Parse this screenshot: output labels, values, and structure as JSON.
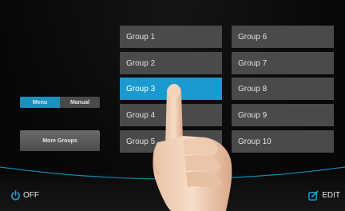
{
  "mode_toggle": {
    "menu_label": "Menu",
    "manual_label": "Manual",
    "selected": "Menu"
  },
  "more_groups_label": "More Groups",
  "groups": [
    {
      "label": "Group 1",
      "active": false
    },
    {
      "label": "Group 2",
      "active": false
    },
    {
      "label": "Group 3",
      "active": true
    },
    {
      "label": "Group 4",
      "active": false
    },
    {
      "label": "Group 5",
      "active": false
    },
    {
      "label": "Group 6",
      "active": false
    },
    {
      "label": "Group 7",
      "active": false
    },
    {
      "label": "Group 8",
      "active": false
    },
    {
      "label": "Group 9",
      "active": false
    },
    {
      "label": "Group 10",
      "active": false
    }
  ],
  "bottom_bar": {
    "off_label": "OFF",
    "edit_label": "EDIT"
  },
  "colors": {
    "accent": "#1a9ad0",
    "button": "#4a4a4a",
    "background": "#0b0b0c"
  },
  "icons": {
    "power": "power-icon",
    "edit": "edit-icon",
    "hand": "pointing-hand"
  }
}
